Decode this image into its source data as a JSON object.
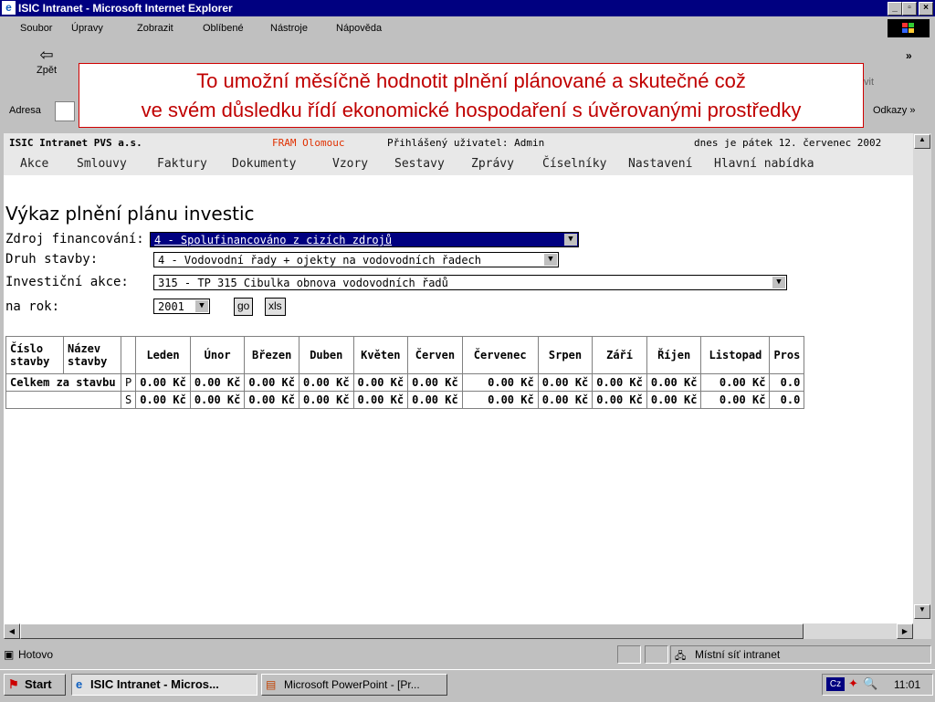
{
  "window": {
    "title": "ISIC Intranet - Microsoft Internet Explorer"
  },
  "menu": [
    "Soubor",
    "Úpravy",
    "Zobrazit",
    "Oblíbené",
    "Nástroje",
    "Nápověda"
  ],
  "toolbar": {
    "back_label": "Zpět",
    "print_label": "vit"
  },
  "address": {
    "label": "Adresa",
    "links_label": "Odkazy »"
  },
  "callout": {
    "line1": "To umožní měsíčně hodnotit plnění plánované a skutečné což",
    "line2": "ve svém důsledku řídí ekonomické hospodaření s úvěrovanými prostředky"
  },
  "app": {
    "company": "ISIC Intranet PVS a.s.",
    "location": "FRAM Olomouc",
    "user": "Přihlášený uživatel: Admin",
    "date": "dnes je pátek 12. červenec 2002",
    "nav": [
      "Akce",
      "Smlouvy",
      "Faktury",
      "Dokumenty",
      "Vzory",
      "Sestavy",
      "Zprávy",
      "Číselníky",
      "Nastavení",
      "Hlavní nabídka"
    ]
  },
  "form": {
    "title": "Výkaz plnění plánu investic",
    "zdroj_label": "Zdroj financování:",
    "zdroj_value": "4 - Spolufinancováno z cizích zdrojů",
    "druh_label": "Druh stavby:",
    "druh_value": "4 - Vodovodní řady + ojekty na vodovodních řadech",
    "akce_label": "Investiční akce:",
    "akce_value": "315 - TP 315 Cibulka obnova vodovodních řadů",
    "rok_label": "na rok:",
    "rok_value": "2001",
    "go_label": "go",
    "xls_label": "xls"
  },
  "table": {
    "headers": [
      "Číslo stavby",
      "Název stavby",
      "",
      "Leden",
      "Únor",
      "Březen",
      "Duben",
      "Květen",
      "Červen",
      "Červenec",
      "Srpen",
      "Září",
      "Říjen",
      "Listopad",
      "Pros"
    ],
    "rows": [
      {
        "label": "Celkem za stavbu",
        "type": "P",
        "values": [
          "0.00 Kč",
          "0.00 Kč",
          "0.00 Kč",
          "0.00 Kč",
          "0.00 Kč",
          "0.00 Kč",
          "0.00 Kč",
          "0.00 Kč",
          "0.00 Kč",
          "0.00 Kč",
          "0.00 Kč",
          "0.0"
        ]
      },
      {
        "label": "",
        "type": "S",
        "values": [
          "0.00 Kč",
          "0.00 Kč",
          "0.00 Kč",
          "0.00 Kč",
          "0.00 Kč",
          "0.00 Kč",
          "0.00 Kč",
          "0.00 Kč",
          "0.00 Kč",
          "0.00 Kč",
          "0.00 Kč",
          "0.0"
        ]
      }
    ]
  },
  "status": {
    "left": "Hotovo",
    "zone": "Místní síť intranet"
  },
  "taskbar": {
    "start": "Start",
    "tasks": [
      "ISIC Intranet - Micros...",
      "Microsoft PowerPoint - [Pr..."
    ],
    "lang": "Cz",
    "clock": "11:01"
  }
}
